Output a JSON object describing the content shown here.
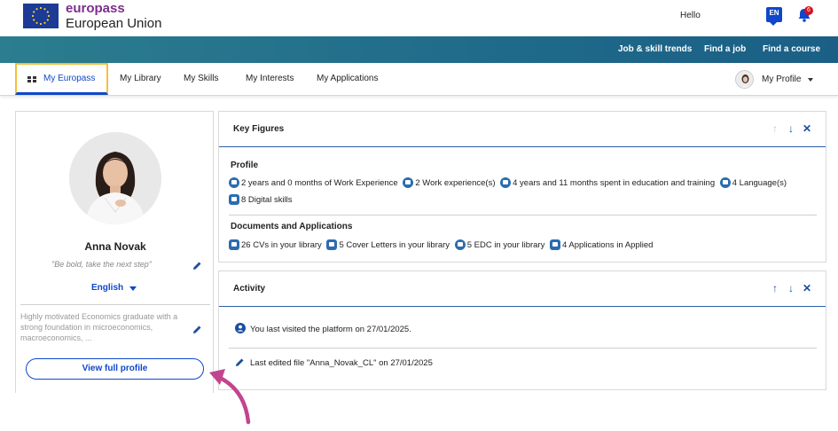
{
  "brand": {
    "top": "europass",
    "bottom": "European Union"
  },
  "header": {
    "greeting": "Hello",
    "language_badge": "EN",
    "notification_count": "6"
  },
  "top_links": [
    "Job & skill trends",
    "Find a job",
    "Find a course"
  ],
  "tabs": [
    {
      "label": "My Europass"
    },
    {
      "label": "My Library"
    },
    {
      "label": "My Skills"
    },
    {
      "label": "My Interests"
    },
    {
      "label": "My Applications"
    }
  ],
  "profile_menu": {
    "label": "My Profile"
  },
  "profile": {
    "name": "Anna Novak",
    "motto": "\"Be bold, take the next step\"",
    "language": "English",
    "summary": "Highly motivated Economics graduate with a strong foundation in microeconomics, macroeconomics, ...",
    "view_button": "View full profile"
  },
  "key_figures": {
    "title": "Key Figures",
    "profile_section": "Profile",
    "profile_items": [
      "2 years and 0 months of Work Experience",
      "2 Work experience(s)",
      "4 years and 11 months spent in education and training",
      "4 Language(s)",
      "8 Digital skills"
    ],
    "documents_section": "Documents and Applications",
    "document_items": [
      "26 CVs in your library",
      "5 Cover Letters in your library",
      "5 EDC in your library",
      "4 Applications in Applied"
    ]
  },
  "activity": {
    "title": "Activity",
    "items": [
      "You last visited the platform on 27/01/2025.",
      "Last edited file \"Anna_Novak_CL\" on 27/01/2025"
    ]
  },
  "colors": {
    "accent": "#0e47cb",
    "band": "#1f6a8a",
    "brand_purple": "#7a2e8c",
    "arrow": "#c2448f",
    "tab_focus": "#f3c13a"
  }
}
